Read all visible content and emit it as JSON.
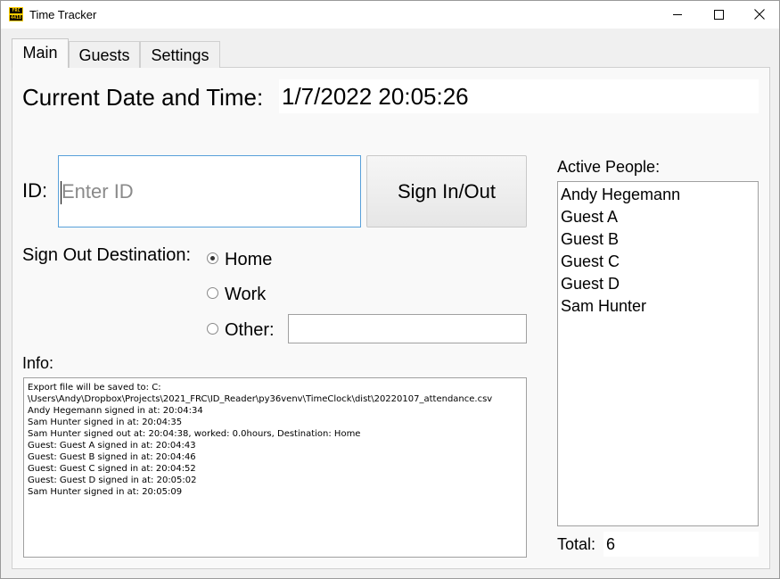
{
  "window": {
    "title": "Time Tracker",
    "icon_text": [
      "FRC",
      "4418"
    ]
  },
  "tabs": [
    {
      "label": "Main",
      "selected": true
    },
    {
      "label": "Guests",
      "selected": false
    },
    {
      "label": "Settings",
      "selected": false
    }
  ],
  "main": {
    "datetime_label": "Current Date and Time:",
    "datetime_value": "1/7/2022 20:05:26",
    "id_label": "ID:",
    "id_placeholder": "Enter ID",
    "id_value": "",
    "sign_button": "Sign In/Out",
    "destination_label": "Sign Out Destination:",
    "destinations": [
      {
        "label": "Home",
        "selected": true
      },
      {
        "label": "Work",
        "selected": false
      },
      {
        "label": "Other:",
        "selected": false
      }
    ],
    "other_value": "",
    "info_label": "Info:",
    "info_lines": [
      "Export file will be saved to: C:",
      "\\Users\\Andy\\Dropbox\\Projects\\2021_FRC\\ID_Reader\\py36venv\\TimeClock\\dist\\20220107_attendance.csv",
      "Andy Hegemann signed in at: 20:04:34",
      "Sam Hunter signed in at: 20:04:35",
      "Sam Hunter signed out at: 20:04:38, worked: 0.0hours, Destination: Home",
      "Guest: Guest A signed in at: 20:04:43",
      "Guest: Guest B signed in at: 20:04:46",
      "Guest: Guest C signed in at: 20:04:52",
      "Guest: Guest D signed in at: 20:05:02",
      "Sam Hunter signed in at: 20:05:09"
    ],
    "active_label": "Active People:",
    "active_people": [
      "Andy Hegemann",
      "Guest A",
      "Guest B",
      "Guest C",
      "Guest D",
      "Sam Hunter"
    ],
    "total_label": "Total:",
    "total_value": "6"
  },
  "icons": {
    "minimize": "minimize-icon",
    "maximize": "maximize-icon",
    "close": "close-icon",
    "radio": "radio-button-icon"
  },
  "colors": {
    "window_bg": "#f0f0f0",
    "panel_bg": "#f9f9f9",
    "input_focus_border": "#58a0da",
    "placeholder_text": "#8a8a8a",
    "app_icon_yellow": "#ffd000"
  }
}
